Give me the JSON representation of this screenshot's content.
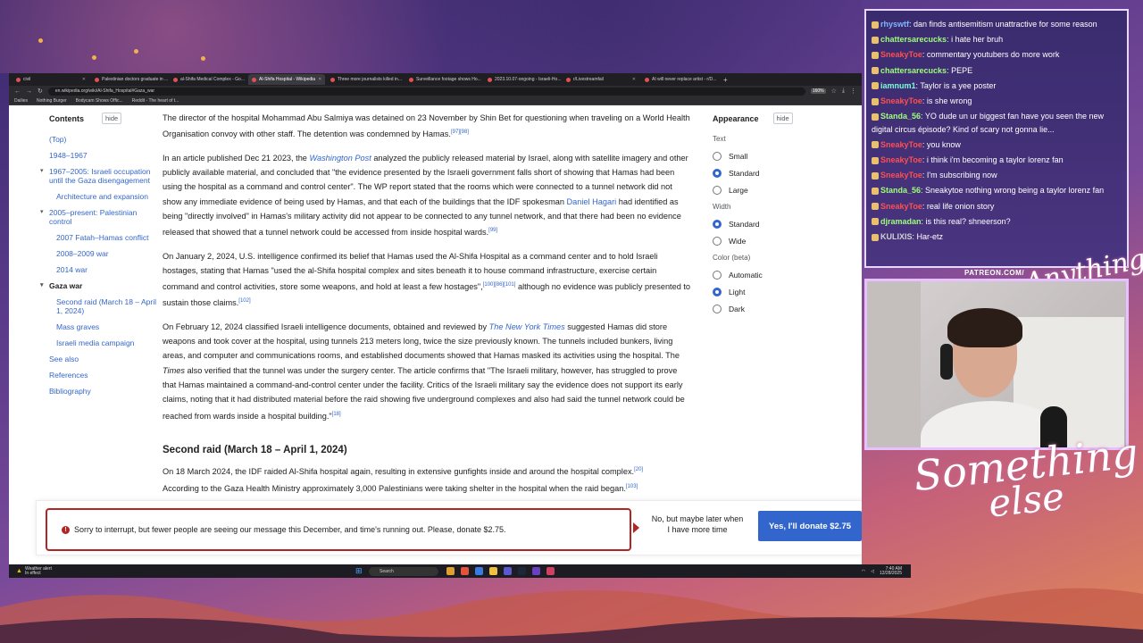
{
  "browser": {
    "tabs": [
      {
        "label": "civil",
        "active": false
      },
      {
        "label": "Palestinian doctors graduate in ...",
        "active": false
      },
      {
        "label": "al-Shifa Medical Complex - Go...",
        "active": false
      },
      {
        "label": "Al-Shifa Hospital - Wikipedia",
        "active": true
      },
      {
        "label": "Three more journalists killed in...",
        "active": false
      },
      {
        "label": "Surveillance footage shows Ho...",
        "active": false
      },
      {
        "label": "2023.10.07-ongoing - Israeli-Ho...",
        "active": false
      },
      {
        "label": "r/Livestreamfail",
        "active": false
      },
      {
        "label": "AI will never replace artist - r/D...",
        "active": false
      }
    ],
    "url": "en.wikipedia.org/wiki/Al-Shifa_Hospital#Gaza_war",
    "zoom": "160%",
    "bookmarks": [
      "Dailies",
      "Nothing Burger",
      "Bodycam Shows Offic...",
      "Reddit - The heart of t..."
    ]
  },
  "toc": {
    "title": "Contents",
    "hide": "hide",
    "items": [
      {
        "label": "(Top)",
        "level": 1
      },
      {
        "label": "1948–1967",
        "level": 1
      },
      {
        "label": "1967–2005: Israeli occupation until the Gaza disengagement",
        "level": 1,
        "caret": true
      },
      {
        "label": "Architecture and expansion",
        "level": 2
      },
      {
        "label": "2005–present: Palestinian control",
        "level": 1,
        "caret": true
      },
      {
        "label": "2007 Fatah–Hamas conflict",
        "level": 2
      },
      {
        "label": "2008–2009 war",
        "level": 2
      },
      {
        "label": "2014 war",
        "level": 2
      },
      {
        "label": "Gaza war",
        "level": 1,
        "caret": true,
        "current": true
      },
      {
        "label": "Second raid (March 18 – April 1, 2024)",
        "level": 2
      },
      {
        "label": "Mass graves",
        "level": 2
      },
      {
        "label": "Israeli media campaign",
        "level": 2
      },
      {
        "label": "See also",
        "level": 1
      },
      {
        "label": "References",
        "level": 1
      },
      {
        "label": "Bibliography",
        "level": 1
      }
    ]
  },
  "article": {
    "p1": {
      "text": "The director of the hospital Mohammad Abu Salmiya was detained on 23 November by Shin Bet for questioning when traveling on a World Health Organisation convoy with other staff. The detention was condemned by Hamas.",
      "refs": "[97][98]"
    },
    "p2": {
      "a": "In an article published Dec 21 2023, the ",
      "link1": "Washington Post",
      "b": " analyzed the publicly released material by Israel, along with satellite imagery and other publicly available material, and concluded that \"the evidence presented by the Israeli government falls short of showing that Hamas had been using the hospital as a command and control center\". The WP report stated that the rooms which were connected to a tunnel network did not show any immediate evidence of being used by Hamas, and that each of the buildings that the IDF spokesman ",
      "link2": "Daniel Hagari",
      "c": " had identified as being \"directly involved\" in Hamas's military activity did not appear to be connected to any tunnel network, and that there had been no evidence released that showed that a tunnel network could be accessed from inside hospital wards.",
      "refs": "[99]"
    },
    "p3": {
      "a": "On January 2, 2024, U.S. intelligence confirmed its belief that Hamas used the Al-Shifa Hospital as a command center and to hold Israeli hostages, stating that Hamas \"used the al-Shifa hospital complex and sites beneath it to house command infrastructure, exercise certain command and control activities, store some weapons, and hold at least a few hostages\",",
      "refs1": "[100][86][101]",
      "b": " although no evidence was publicly presented to sustain those claims.",
      "refs2": "[102]"
    },
    "p4": {
      "a": "On February 12, 2024 classified Israeli intelligence documents, obtained and reviewed by ",
      "link1": "The New York Times",
      "b": " suggested Hamas did store weapons and took cover at the hospital, using tunnels 213 meters long, twice the size previously known. The tunnels included bunkers, living areas, and computer and communications rooms, and established documents showed that Hamas masked its activities using the hospital. The ",
      "it": "Times",
      "c": " also verified that the tunnel was under the surgery center. The article confirms that \"The Israeli military, however, has struggled to prove that Hamas maintained a command-and-control center under the facility. Critics of the Israeli military say the evidence does not support its early claims, noting that it had distributed material before the raid showing five underground complexes and also had said the tunnel network could be reached from wards inside a hospital building.\"",
      "refs": "[18]"
    },
    "h3": "Second raid (March 18 – April 1, 2024)",
    "p5": {
      "text": "On 18 March 2024, the IDF raided Al-Shifa hospital again, resulting in extensive gunfights inside and around the hospital complex.",
      "refs": "[20]"
    },
    "p6": {
      "text": "According to the Gaza Health Ministry approximately 3,000 Palestinians were taking shelter in the hospital when the raid began.",
      "refs": "[103]"
    }
  },
  "appearance": {
    "title": "Appearance",
    "hide": "hide",
    "text_label": "Text",
    "text_options": [
      {
        "label": "Small",
        "selected": false
      },
      {
        "label": "Standard",
        "selected": true
      },
      {
        "label": "Large",
        "selected": false
      }
    ],
    "width_label": "Width",
    "width_options": [
      {
        "label": "Standard",
        "selected": true
      },
      {
        "label": "Wide",
        "selected": false
      }
    ],
    "color_label": "Color (beta)",
    "color_options": [
      {
        "label": "Automatic",
        "selected": false
      },
      {
        "label": "Light",
        "selected": true
      },
      {
        "label": "Dark",
        "selected": false
      }
    ]
  },
  "banner": {
    "message": "Sorry to interrupt, but fewer people are seeing our message this December, and time's running out. Please, donate $2.75.",
    "no_label": "No, but maybe later when I have more time",
    "yes_label": "Yes, I'll donate $2.75"
  },
  "taskbar": {
    "weather_line1": "Weather alert",
    "weather_line2": "In effect",
    "search": "Search",
    "time": "7:40 AM",
    "date": "12/28/2025"
  },
  "chat": [
    {
      "nick": "rhyswtf",
      "color": "#7fb8ff",
      "text": "dan finds antisemitism unattractive for some reason"
    },
    {
      "nick": "chattersarecucks",
      "color": "#9dff7a",
      "text": "i hate her bruh"
    },
    {
      "nick": "SneakyToe",
      "color": "#ff5050",
      "text": "commentary youtubers do more work"
    },
    {
      "nick": "chattersarecucks",
      "color": "#9dff7a",
      "text": "PEPE"
    },
    {
      "nick": "iamnum1",
      "color": "#7affd9",
      "text": "Taylor is a yee poster"
    },
    {
      "nick": "SneakyToe",
      "color": "#ff5050",
      "text": "is she wrong"
    },
    {
      "nick": "Standa_56",
      "color": "#9dff7a",
      "text": "YO dude un ur biggest fan have you seen the new digital circus épisode? Kind of scary not gonna lie..."
    },
    {
      "nick": "SneakyToe",
      "color": "#ff5050",
      "text": "you know"
    },
    {
      "nick": "SneakyToe",
      "color": "#ff5050",
      "text": "i think i'm becoming a taylor lorenz fan"
    },
    {
      "nick": "SneakyToe",
      "color": "#ff5050",
      "text": "I'm subscribing now"
    },
    {
      "nick": "Standa_56",
      "color": "#9dff7a",
      "text": "Sneakytoe nothing wrong being a taylor lorenz fan"
    },
    {
      "nick": "SneakyToe",
      "color": "#ff5050",
      "text": "real life onion story"
    },
    {
      "nick": "djramadan",
      "color": "#9dff7a",
      "text": "is this real? shneerson?"
    },
    {
      "nick": "KULIXIS",
      "color": "#d0d0d0",
      "text": "Har-etz"
    }
  ],
  "overlay": {
    "patreon": "PATREON.COM/",
    "script1": "Anything else",
    "script2a": "Something",
    "script2b": "else"
  }
}
